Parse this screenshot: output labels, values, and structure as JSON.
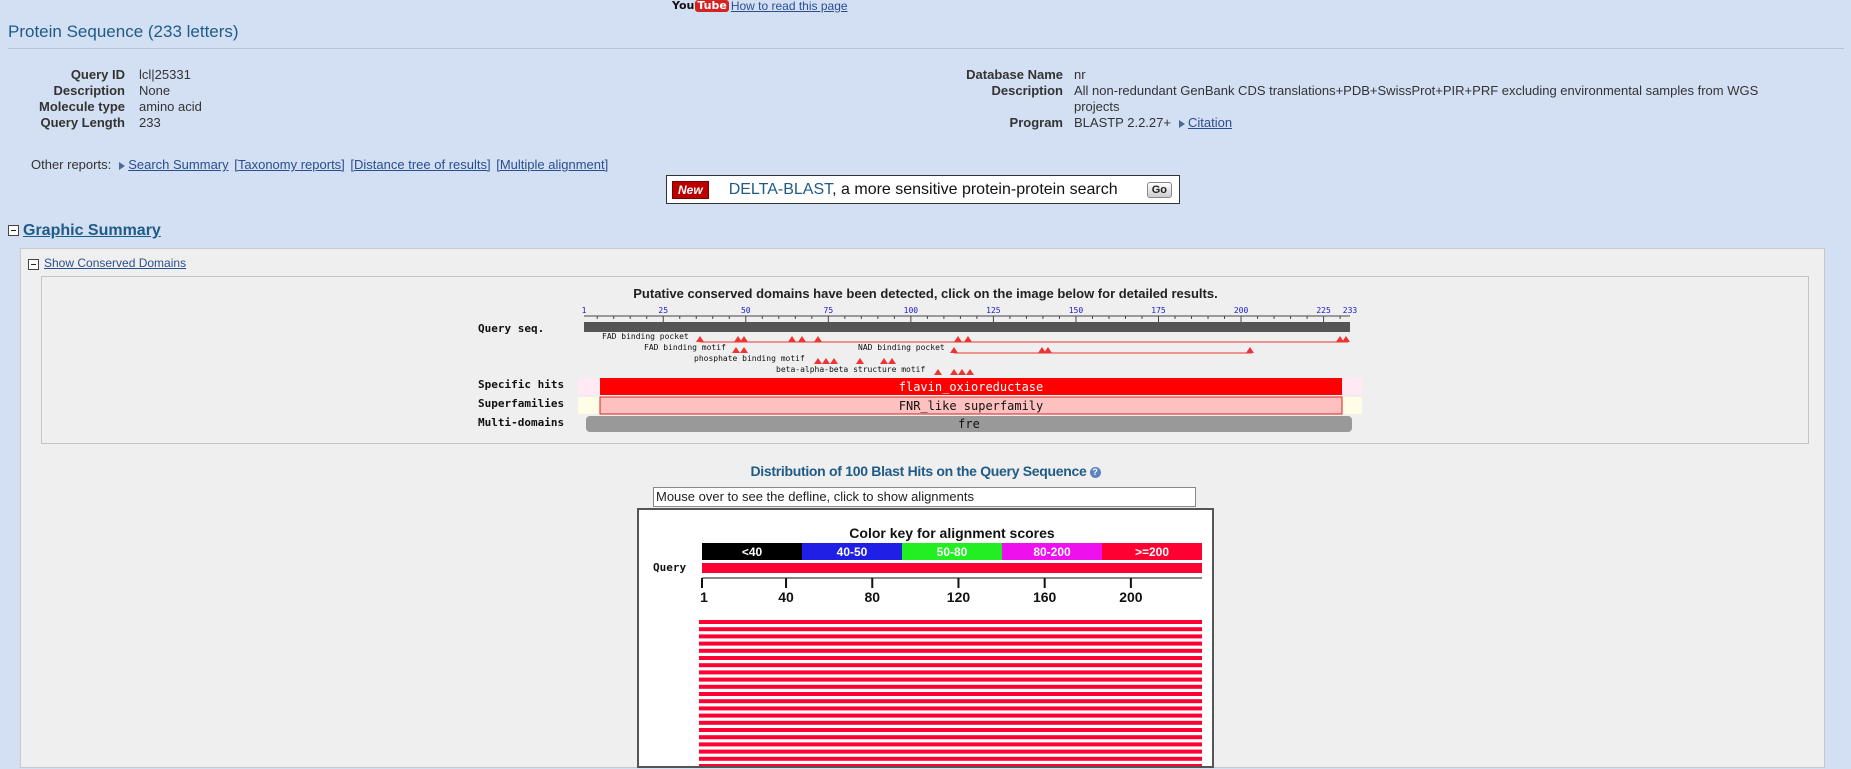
{
  "header": {
    "youtube_logo_you": "You",
    "youtube_logo_tube": "Tube",
    "how_to_read": "How to read this page",
    "title": "Protein Sequence (233 letters)"
  },
  "query": {
    "id_label": "Query ID",
    "id_value": "lcl|25331",
    "desc_label": "Description",
    "desc_value": "None",
    "moltype_label": "Molecule type",
    "moltype_value": "amino acid",
    "length_label": "Query Length",
    "length_value": "233"
  },
  "database": {
    "name_label": "Database Name",
    "name_value": "nr",
    "desc_label": "Description",
    "desc_value_line1": "All non-redundant GenBank CDS translations+PDB+SwissProt+PIR+PRF excluding environmental samples from WGS",
    "desc_value_line2": "projects",
    "program_label": "Program",
    "program_value": "BLASTP 2.2.27+",
    "citation": "Citation"
  },
  "other_reports": {
    "label": "Other reports:",
    "links": [
      "Search Summary",
      "[Taxonomy reports]",
      "[Distance tree of results]",
      "[Multiple alignment]"
    ]
  },
  "delta": {
    "badge": "New",
    "name": "DELTA-BLAST",
    "rest": ", a more sensitive protein-protein search",
    "go": "Go"
  },
  "graphic_summary": {
    "title": "Graphic Summary",
    "show_cd": "Show Conserved Domains",
    "cd_message": "Putative conserved domains have been detected, click on the image below for detailed results."
  },
  "cd_graphic": {
    "query_seq_label": "Query seq.",
    "ticks": [
      "1",
      "25",
      "50",
      "75",
      "100",
      "125",
      "150",
      "175",
      "200",
      "225",
      "233"
    ],
    "feature_labels": [
      "FAD binding pocket",
      "FAD binding motif",
      "NAD binding pocket",
      "phosphate binding motif",
      "beta-alpha-beta structure motif"
    ],
    "row_labels": [
      "Specific hits",
      "Superfamilies",
      "Multi-domains"
    ],
    "specific_hit": "flavin_oxioreductase",
    "superfamily": "FNR_like superfamily",
    "multi_domain": "fre"
  },
  "distribution": {
    "title": "Distribution of 100 Blast Hits on the Query Sequence",
    "help": "?",
    "mouse_over": "Mouse over to see the defline, click to show alignments",
    "color_key_title": "Color key for alignment scores",
    "color_key": [
      {
        "label": "<40",
        "color": "#000000"
      },
      {
        "label": "40-50",
        "color": "#1f1fe6"
      },
      {
        "label": "50-80",
        "color": "#22ee22"
      },
      {
        "label": "80-200",
        "color": "#ee11ee"
      },
      {
        "label": ">=200",
        "color": "#ff0033"
      }
    ],
    "query_label": "Query",
    "axis_ticks": [
      "1",
      "40",
      "80",
      "120",
      "160",
      "200"
    ],
    "hit_color": "#ff0033"
  }
}
